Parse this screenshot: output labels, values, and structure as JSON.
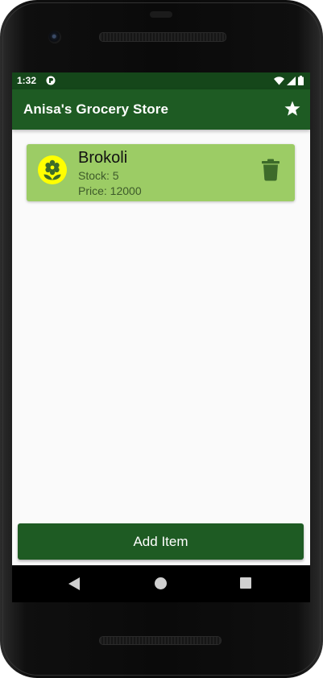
{
  "status_bar": {
    "time": "1:32",
    "app_icon": "data-saver-icon",
    "indicators": [
      "wifi-icon",
      "cell-signal-icon",
      "battery-icon"
    ]
  },
  "app_bar": {
    "title": "Anisa's Grocery Store",
    "action_icon": "star-icon"
  },
  "items": [
    {
      "name": "Brokoli",
      "stock_text": "Stock: 5",
      "price_text": "Price: 12000",
      "avatar_icon": "flower-icon",
      "action_icon": "trash-icon"
    }
  ],
  "add_button": {
    "label": "Add Item"
  },
  "nav_bar": {
    "buttons": [
      "back-icon",
      "home-icon",
      "recents-icon"
    ]
  },
  "colors": {
    "status_bar": "#15471a",
    "app_bar": "#1e5b23",
    "card": "#9ccc65",
    "avatar_bg": "#ffff00",
    "icon_green": "#3d6b2a",
    "screen_bg": "#fafafa"
  }
}
